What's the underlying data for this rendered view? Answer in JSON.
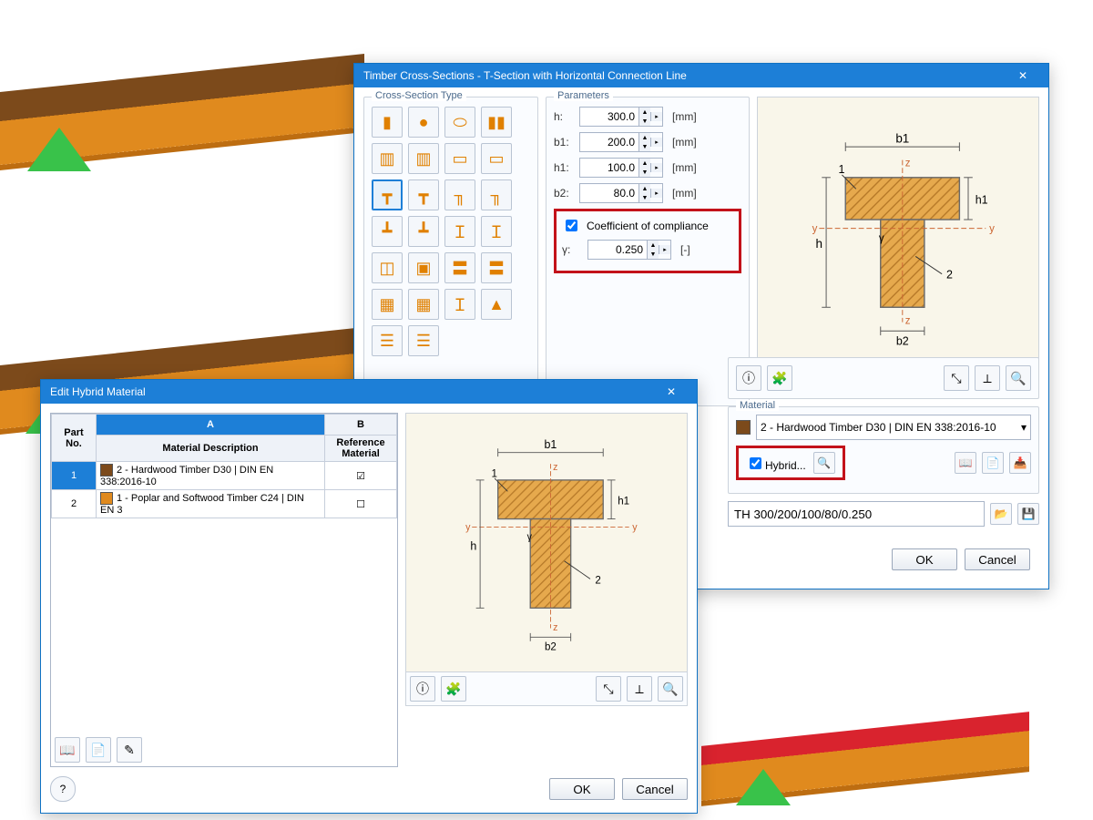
{
  "win1": {
    "title": "Timber Cross-Sections - T-Section with Horizontal Connection Line",
    "cstype_legend": "Cross-Section Type",
    "params_legend": "Parameters",
    "material_legend": "Material",
    "params": {
      "h_label": "h:",
      "h_val": "300.0",
      "h_unit": "[mm]",
      "b1_label": "b1:",
      "b1_val": "200.0",
      "b1_unit": "[mm]",
      "h1_label": "h1:",
      "h1_val": "100.0",
      "h1_unit": "[mm]",
      "b2_label": "b2:",
      "b2_val": "80.0",
      "b2_unit": "[mm]",
      "coeff_label": "Coefficient of compliance",
      "gamma_label": "γ:",
      "gamma_val": "0.250",
      "gamma_unit": "[-]"
    },
    "material_option": "2 - Hardwood Timber D30 | DIN EN 338:2016-10",
    "hybrid_label": "Hybrid...",
    "section_name": "TH 300/200/100/80/0.250",
    "ok": "OK",
    "cancel": "Cancel"
  },
  "win2": {
    "title": "Edit Hybrid Material",
    "col_part": "Part No.",
    "col_A": "A",
    "col_B": "B",
    "hdr_desc": "Material Description",
    "hdr_ref": "Reference Material",
    "rows": {
      "r1_no": "1",
      "r1_desc": "2 - Hardwood Timber D30 | DIN EN 338:2016-10",
      "r1_ref": "☑",
      "r2_no": "2",
      "r2_desc": "1 - Poplar and Softwood Timber C24 | DIN EN 3",
      "r2_ref": "☐"
    },
    "ok": "OK",
    "cancel": "Cancel"
  },
  "diagram_labels": {
    "b1": "b1",
    "b2": "b2",
    "h": "h",
    "h1": "h1",
    "one": "1",
    "two": "2",
    "y": "y",
    "z": "z",
    "gamma": "γ"
  }
}
